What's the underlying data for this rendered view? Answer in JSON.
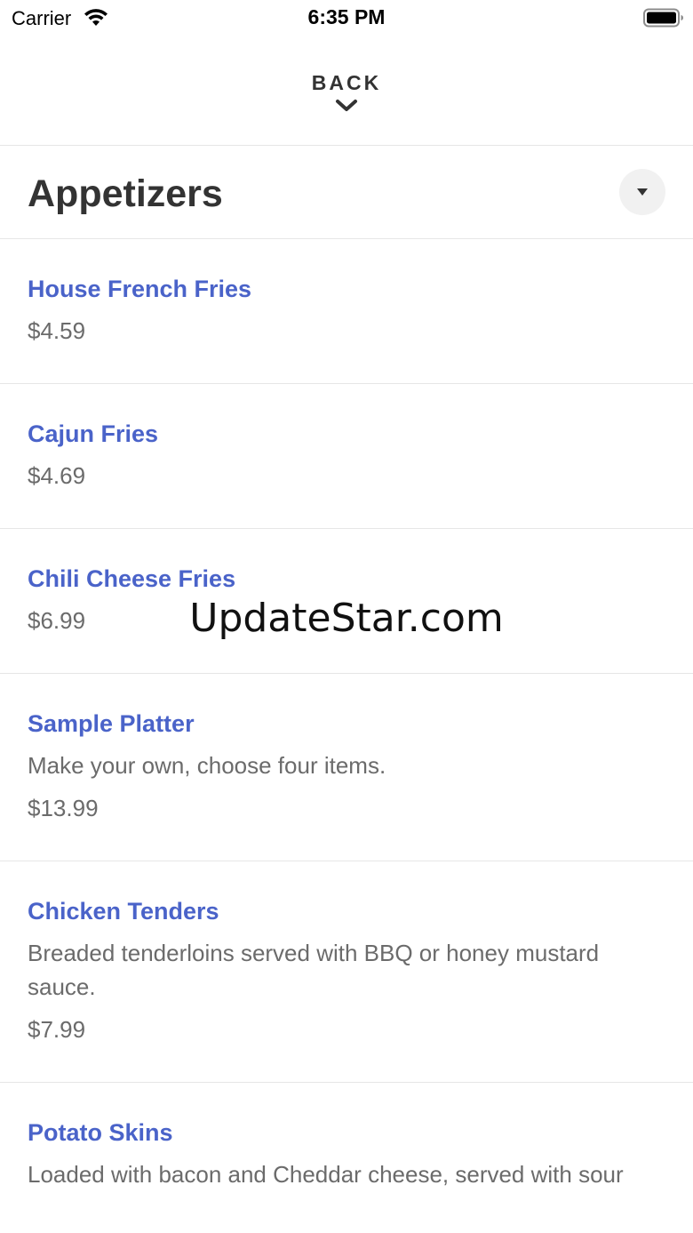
{
  "status_bar": {
    "carrier": "Carrier",
    "time": "6:35 PM",
    "wifi_icon": "wifi-icon",
    "battery_icon": "battery-full-icon"
  },
  "header": {
    "back_label": "BACK",
    "back_icon": "chevron-down-icon"
  },
  "section": {
    "title": "Appetizers",
    "dropdown_icon": "caret-down-icon"
  },
  "menu": {
    "items": [
      {
        "name": "House French Fries",
        "description": "",
        "price": "$4.59"
      },
      {
        "name": "Cajun Fries",
        "description": "",
        "price": "$4.69"
      },
      {
        "name": "Chili Cheese Fries",
        "description": "",
        "price": "$6.99"
      },
      {
        "name": "Sample Platter",
        "description": "Make your own, choose four items.",
        "price": "$13.99"
      },
      {
        "name": "Chicken Tenders",
        "description": "Breaded tenderloins served with BBQ or honey mustard sauce.",
        "price": "$7.99"
      },
      {
        "name": "Potato Skins",
        "description": "Loaded with bacon and Cheddar cheese, served with sour",
        "price": ""
      }
    ]
  },
  "watermark": "UpdateStar.com",
  "colors": {
    "accent": "#4a63c9",
    "text": "#333333",
    "muted": "#6b6b6b",
    "divider": "#e6e6e6"
  }
}
